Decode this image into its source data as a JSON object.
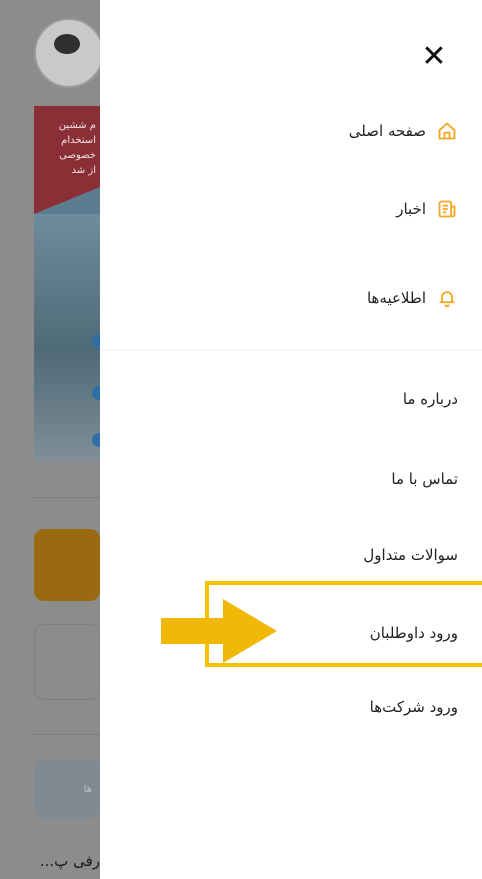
{
  "background": {
    "banner_text_lines": [
      "م ششین",
      "استخدام",
      "خصوصی",
      "از شد"
    ],
    "chip_text": "ها",
    "bottom_text": "رفی پ..."
  },
  "drawer": {
    "close_label": "✕",
    "primary_items": [
      {
        "label": "صفحه اصلی",
        "icon": "home-icon"
      },
      {
        "label": "اخبار",
        "icon": "news-icon"
      },
      {
        "label": "اطلاعیه‌ها",
        "icon": "bell-icon"
      }
    ],
    "secondary_items": [
      {
        "label": "درباره ما"
      },
      {
        "label": "تماس با ما"
      },
      {
        "label": "سوالات متداول"
      },
      {
        "label": "ورود داوطلبان"
      },
      {
        "label": "ورود شرکت‌ها"
      }
    ]
  },
  "colors": {
    "accent": "#f5a623",
    "highlight": "#f3c300",
    "arrow": "#f2b807"
  }
}
